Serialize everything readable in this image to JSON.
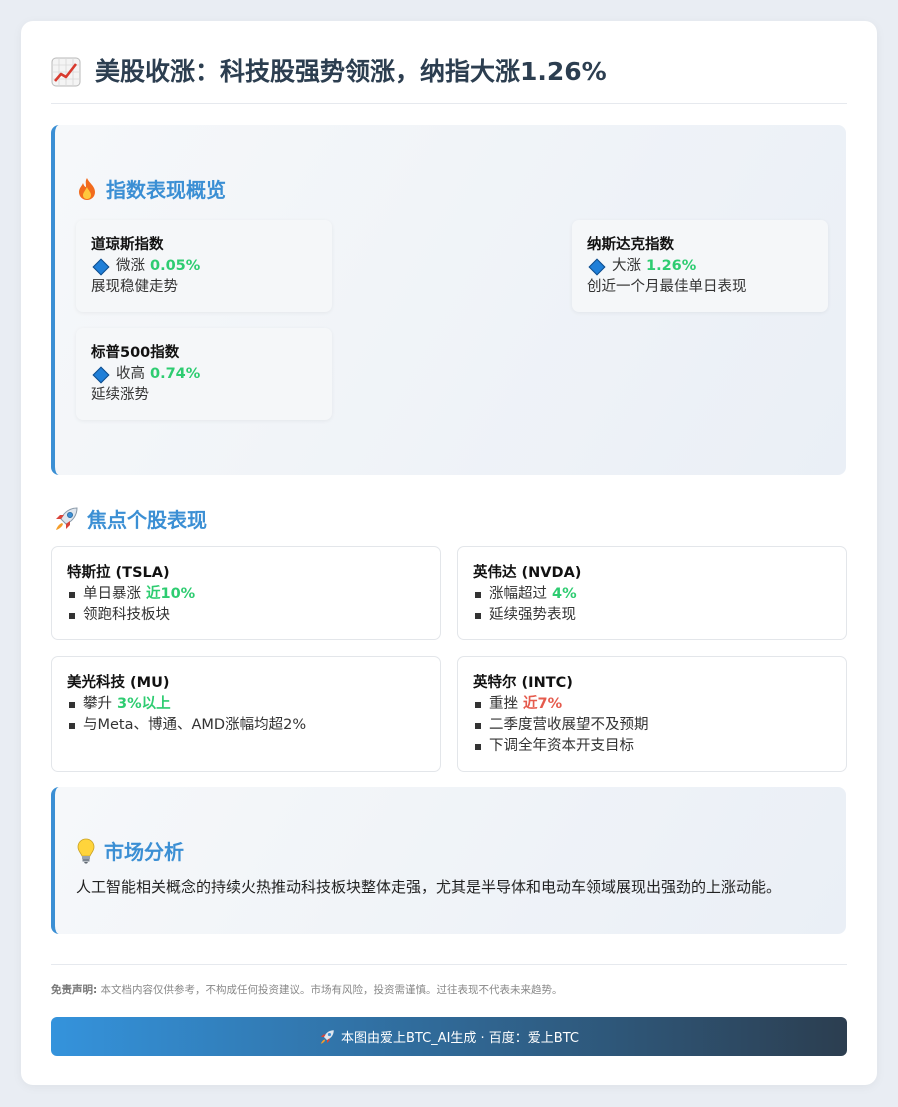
{
  "title": "美股收涨：科技股强势领涨，纳指大涨1.26%",
  "indices": {
    "heading": "指数表现概览",
    "cards": [
      {
        "name": "道琼斯指数",
        "verb": "微涨",
        "value": "0.05%",
        "desc": "展现稳健走势"
      },
      {
        "name": "纳斯达克指数",
        "verb": "大涨",
        "value": "1.26%",
        "desc": "创近一个月最佳单日表现"
      },
      {
        "name": "标普500指数",
        "verb": "收高",
        "value": "0.74%",
        "desc": "延续涨势"
      }
    ]
  },
  "stocks": {
    "heading": "焦点个股表现",
    "tsla": {
      "name": "特斯拉 (TSLA)",
      "b1_text": "单日暴涨",
      "b1_value": "近10%",
      "b2": "领跑科技板块"
    },
    "nvda": {
      "name": "英伟达 (NVDA)",
      "b1_text": "涨幅超过",
      "b1_value": "4%",
      "b2": "延续强势表现"
    },
    "mu": {
      "name": "美光科技 (MU)",
      "b1_text": "攀升",
      "b1_value": "3%以上",
      "b2": "与Meta、博通、AMD涨幅均超2%"
    },
    "intc": {
      "name": "英特尔 (INTC)",
      "b1_text": "重挫",
      "b1_value": "近7%",
      "b2": "二季度营收展望不及预期",
      "b3": "下调全年资本开支目标"
    }
  },
  "analysis": {
    "heading": "市场分析",
    "text": "人工智能相关概念的持续火热推动科技板块整体走强，尤其是半导体和电动车领域展现出强劲的上涨动能。"
  },
  "disclaimer": {
    "label": "免责声明:",
    "text": "本文档内容仅供参考，不构成任何投资建议。市场有风险，投资需谨慎。过往表现不代表未来趋势。"
  },
  "footer": {
    "text": "本图由爱上BTC_AI生成 · 百度：爱上BTC"
  },
  "colors": {
    "accent": "#3b8fd4",
    "up": "#2ecc71",
    "down": "#e55b4d",
    "title": "#2c3e50"
  },
  "icons": [
    "chart-up-icon",
    "fire-icon",
    "rocket-icon",
    "lightbulb-icon",
    "diamond-icon"
  ]
}
